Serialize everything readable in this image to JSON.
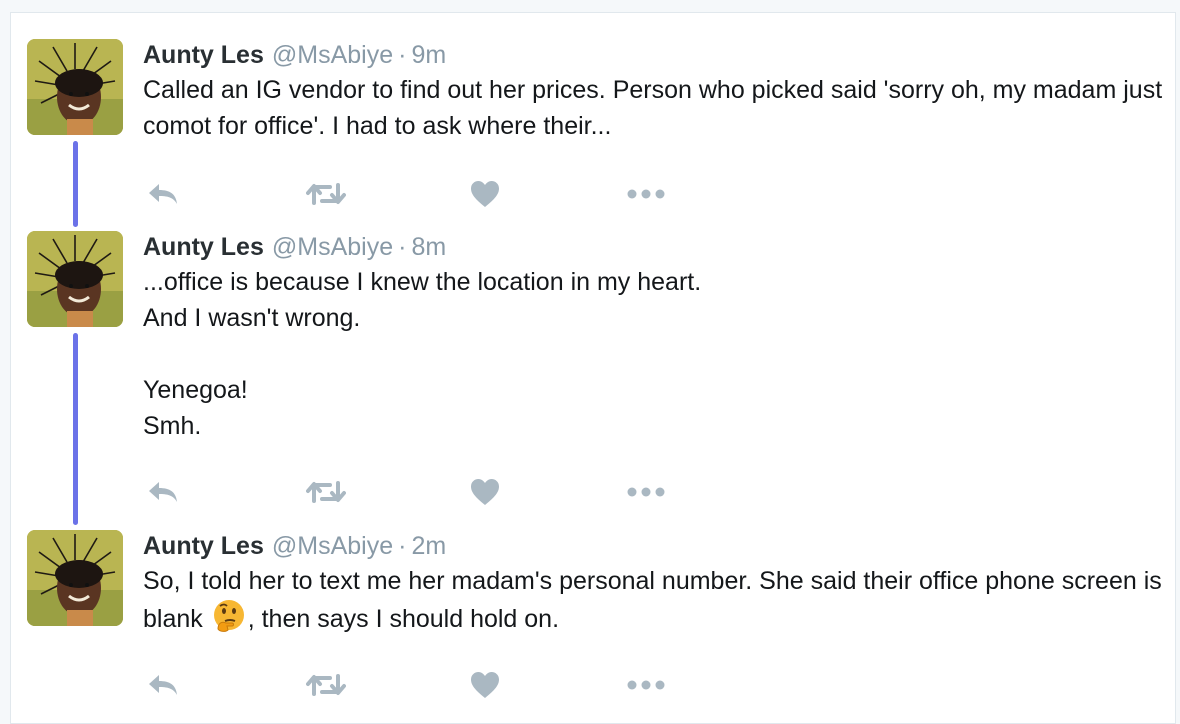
{
  "tweets": [
    {
      "name": "Aunty Les",
      "handle": "@MsAbiye",
      "separator": "·",
      "time": "9m",
      "text": "Called an IG vendor to find out her prices. Person who picked said 'sorry oh, my madam just comot for office'. I had to ask where their...",
      "actions": [
        "reply-icon",
        "retweet-icon",
        "like-icon",
        "more-icon"
      ]
    },
    {
      "name": "Aunty Les",
      "handle": "@MsAbiye",
      "separator": "·",
      "time": "8m",
      "text": "...office is because I knew the location in my heart.\nAnd I wasn't wrong.\n\nYenegoa!\nSmh.",
      "actions": [
        "reply-icon",
        "retweet-icon",
        "like-icon",
        "more-icon"
      ]
    },
    {
      "name": "Aunty Les",
      "handle": "@MsAbiye",
      "separator": "·",
      "time": "2m",
      "text_before_emoji": "So, I told her to text me her madam's personal number. She said their office phone screen is blank ",
      "emoji": "thinking-face",
      "text_after_emoji": ", then says I should hold on.",
      "actions": [
        "reply-icon",
        "retweet-icon",
        "like-icon",
        "more-icon"
      ]
    }
  ],
  "colors": {
    "thread_line": "#6b72e8",
    "action_icon": "#aab8c2",
    "handle": "#8899a6",
    "name": "#292f33",
    "text": "#14171a"
  }
}
